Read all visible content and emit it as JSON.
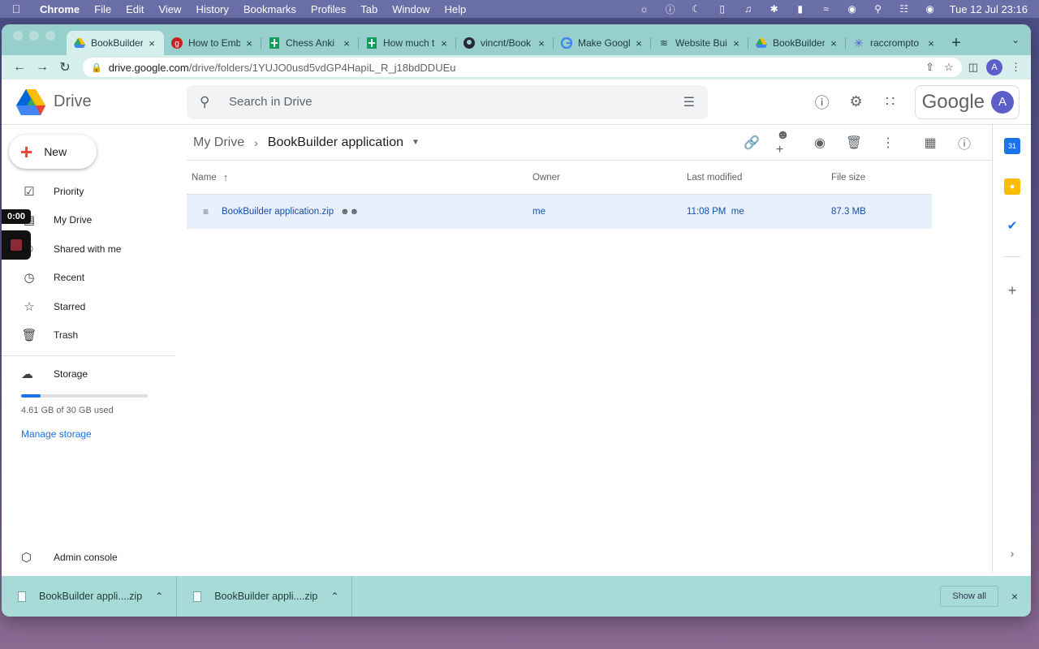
{
  "menubar": {
    "app": "Chrome",
    "items": [
      "File",
      "Edit",
      "View",
      "History",
      "Bookmarks",
      "Profiles",
      "Tab",
      "Window",
      "Help"
    ],
    "clock": "Tue 12 Jul  23:16"
  },
  "tabs": [
    {
      "label": "BookBuilder",
      "icon": "google-drive-icon",
      "active": true
    },
    {
      "label": "How to Emb",
      "icon": "red-g-icon"
    },
    {
      "label": "Chess Anki S",
      "icon": "sheets-icon"
    },
    {
      "label": "How much ti",
      "icon": "sheets-icon"
    },
    {
      "label": "vincnt/Book",
      "icon": "github-icon"
    },
    {
      "label": "Make Googl",
      "icon": "google-icon"
    },
    {
      "label": "Website Bui",
      "icon": "webflow-icon"
    },
    {
      "label": "BookBuilder",
      "icon": "google-drive-icon"
    },
    {
      "label": "raccrompto",
      "icon": "asterisk-icon"
    }
  ],
  "address": {
    "domain": "drive.google.com",
    "path": "/drive/folders/1YUJO0usd5vdGP4HapiL_R_j18bdDDUEu"
  },
  "profile_initial": "A",
  "drive": {
    "product": "Drive",
    "search_placeholder": "Search in Drive",
    "google_word": "Google",
    "new_label": "New",
    "nav": [
      {
        "label": "Priority",
        "icon": "priority-icon"
      },
      {
        "label": "My Drive",
        "icon": "my-drive-icon"
      },
      {
        "label": "Shared with me",
        "icon": "shared-icon"
      },
      {
        "label": "Recent",
        "icon": "clock-icon"
      },
      {
        "label": "Starred",
        "icon": "star-icon"
      },
      {
        "label": "Trash",
        "icon": "trash-icon"
      }
    ],
    "storage": {
      "label": "Storage",
      "used_text": "4.61 GB of 30 GB used",
      "used_fraction": 0.154,
      "manage_label": "Manage storage"
    },
    "admin_label": "Admin console",
    "recorder_time": "0:00",
    "breadcrumb": {
      "root": "My Drive",
      "current": "BookBuilder application"
    },
    "columns": {
      "name": "Name",
      "owner": "Owner",
      "modified": "Last modified",
      "size": "File size"
    },
    "files": [
      {
        "name": "BookBuilder application.zip",
        "owner": "me",
        "modified": "11:08 PM",
        "modified_by": "me",
        "size": "87.3 MB"
      }
    ]
  },
  "downloads": [
    {
      "label": "BookBuilder appli....zip"
    },
    {
      "label": "BookBuilder appli....zip"
    }
  ],
  "show_all_label": "Show all",
  "colors": {
    "accent": "#1a73e8",
    "tabstrip": "#97cfcd",
    "selected_row": "#e8f0fe"
  }
}
